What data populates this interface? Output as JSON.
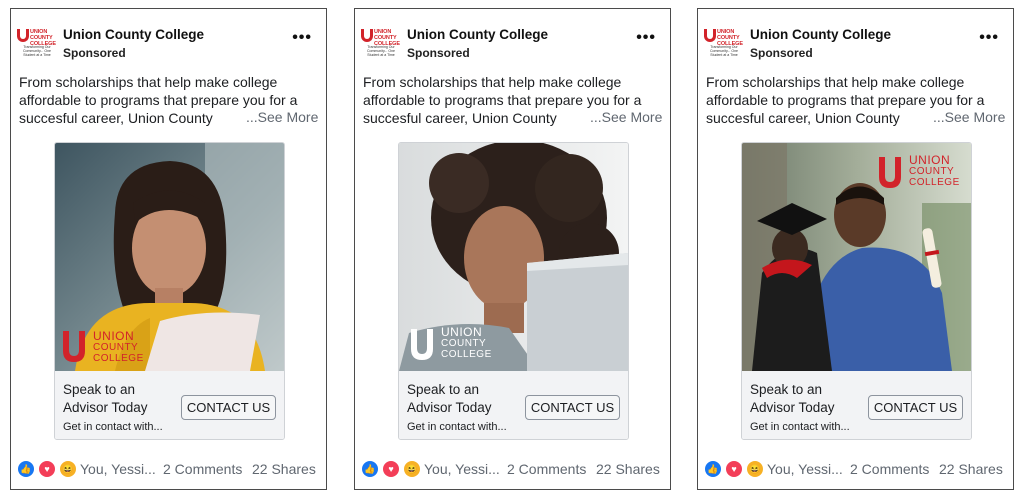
{
  "colors": {
    "brand_red": "#d2232a",
    "facebook_blue": "#1877f2",
    "love_red": "#f33e58",
    "haha_yellow": "#f7b125"
  },
  "logo": {
    "line1": "UNION",
    "line2": "COUNTY",
    "line3": "COLLEGE",
    "tagline": "Transforming Our Community... One Student at a Time"
  },
  "brand_overlay": {
    "line1": "UNION",
    "line2": "COUNTY",
    "line3": "COLLEGE"
  },
  "posts": [
    {
      "page_name": "Union County College",
      "sponsored": "Sponsored",
      "more": "•••",
      "text_lines": [
        "From scholarships that help make college",
        "affordable to programs that prepare you for a",
        "succesful career, Union County"
      ],
      "see_more": "...See More",
      "image": "woman-reading-photo",
      "cta_title": "Speak to an Advisor Today",
      "cta_sub": "Get in contact with...",
      "cta_button": "CONTACT US",
      "reaction_names": "You, Yessi...",
      "comments": "2 Comments",
      "shares": "22 Shares"
    },
    {
      "page_name": "Union County College",
      "sponsored": "Sponsored",
      "more": "•••",
      "text_lines": [
        "From scholarships that help make college",
        "affordable to programs that prepare you for a",
        "succesful career, Union County"
      ],
      "see_more": "...See More",
      "image": "woman-laptop-photo",
      "cta_title": "Speak to an Advisor Today",
      "cta_sub": "Get in contact with...",
      "cta_button": "CONTACT US",
      "reaction_names": "You, Yessi...",
      "comments": "2 Comments",
      "shares": "22 Shares"
    },
    {
      "page_name": "Union County College",
      "sponsored": "Sponsored",
      "more": "•••",
      "text_lines": [
        "From scholarships that help make college",
        "affordable to programs that prepare you for a",
        "succesful career, Union County"
      ],
      "see_more": "...See More",
      "image": "graduates-hugging-photo",
      "cta_title": "Speak to an Advisor Today",
      "cta_sub": "Get in contact with...",
      "cta_button": "CONTACT US",
      "reaction_names": "You, Yessi...",
      "comments": "2 Comments",
      "shares": "22 Shares"
    }
  ]
}
